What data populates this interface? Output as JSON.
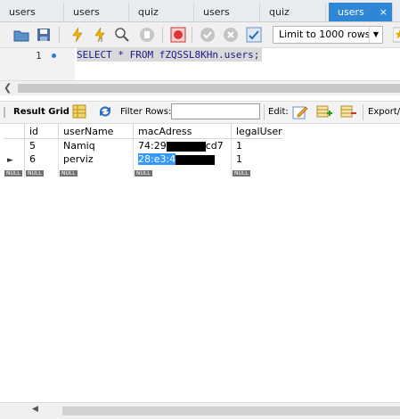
{
  "tabs": [
    {
      "label": "users",
      "active": false
    },
    {
      "label": "users",
      "active": false
    },
    {
      "label": "quiz",
      "active": false
    },
    {
      "label": "users",
      "active": false
    },
    {
      "label": "quiz",
      "active": false
    },
    {
      "label": "users",
      "active": true
    }
  ],
  "tab_close": "×",
  "toolbar": {
    "limit_label": "Limit to 1000 rows"
  },
  "editor": {
    "line": "1",
    "sql_keyword1": "SELECT",
    "sql_star": "*",
    "sql_keyword2": "FROM",
    "sql_table": "fZQSSL8KHn.users;"
  },
  "result_toolbar": {
    "result_grid": "Result Grid",
    "filter_rows": "Filter Rows:",
    "edit": "Edit:",
    "export": "Export/I"
  },
  "grid": {
    "columns": [
      "id",
      "userName",
      "macAdress",
      "legalUser"
    ],
    "rows": [
      {
        "id": "5",
        "userName": "Namiq",
        "mac_prefix": "74:29",
        "mac_suffix": "cd7",
        "legalUser": "1"
      },
      {
        "id": "6",
        "userName": "perviz",
        "mac_prefix": "28:e3:4",
        "mac_suffix": "",
        "legalUser": "1"
      }
    ],
    "null_label": "NULL"
  },
  "colors": {
    "tab_active": "#2e86d6",
    "selection": "#3399ff"
  }
}
